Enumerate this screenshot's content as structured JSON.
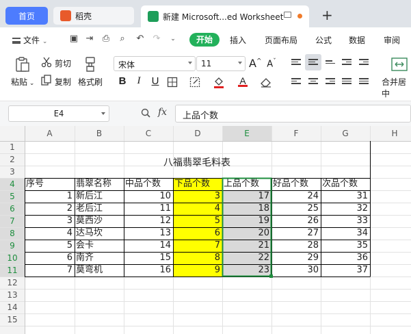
{
  "tabs": {
    "home": "首页",
    "daoke": "稻壳",
    "active": "新建 Microsoft...ed Worksheet",
    "new_tab": "+"
  },
  "ribbon_tabs": {
    "file": "文件",
    "start": "开始",
    "insert": "插入",
    "page_layout": "页面布局",
    "formula": "公式",
    "data": "数据",
    "review": "审阅"
  },
  "toolbar": {
    "paste": "粘贴",
    "cut": "剪切",
    "copy": "复制",
    "format_painter": "格式刷",
    "font_name": "宋体",
    "font_size": "11",
    "bold": "B",
    "italic": "I",
    "underline": "U",
    "merge_center": "合并居中",
    "grow_font": "A",
    "shrink_font": "A"
  },
  "formula_bar": {
    "cell_ref": "E4",
    "fx": "fx",
    "content": "上品个数"
  },
  "columns": [
    "A",
    "B",
    "C",
    "D",
    "E",
    "F",
    "G",
    "H"
  ],
  "rows": [
    "1",
    "2",
    "3",
    "4",
    "5",
    "6",
    "7",
    "8",
    "9",
    "10",
    "11",
    "12",
    "13",
    "14",
    "15"
  ],
  "sheet": {
    "title": "八福翡翠毛料表",
    "headers": [
      "序号",
      "翡翠名称",
      "中品个数",
      "下品个数",
      "上品个数",
      "好品个数",
      "次品个数"
    ],
    "data": [
      [
        "1",
        "新后江",
        "10",
        "3",
        "17",
        "24",
        "31"
      ],
      [
        "2",
        "老后江",
        "11",
        "4",
        "18",
        "25",
        "32"
      ],
      [
        "3",
        "莫西沙",
        "12",
        "5",
        "19",
        "26",
        "33"
      ],
      [
        "4",
        "达马坎",
        "13",
        "6",
        "20",
        "27",
        "34"
      ],
      [
        "5",
        "会卡",
        "14",
        "7",
        "21",
        "28",
        "35"
      ],
      [
        "6",
        "南齐",
        "15",
        "8",
        "22",
        "29",
        "36"
      ],
      [
        "7",
        "莫弯机",
        "16",
        "9",
        "23",
        "30",
        "37"
      ]
    ]
  },
  "colors": {
    "accent_green": "#23b15b",
    "home_tab": "#4d7cfe",
    "highlight_yellow": "#ffff00",
    "selection_gray": "#d9d9d9",
    "selection_border": "#1e8e3e"
  }
}
